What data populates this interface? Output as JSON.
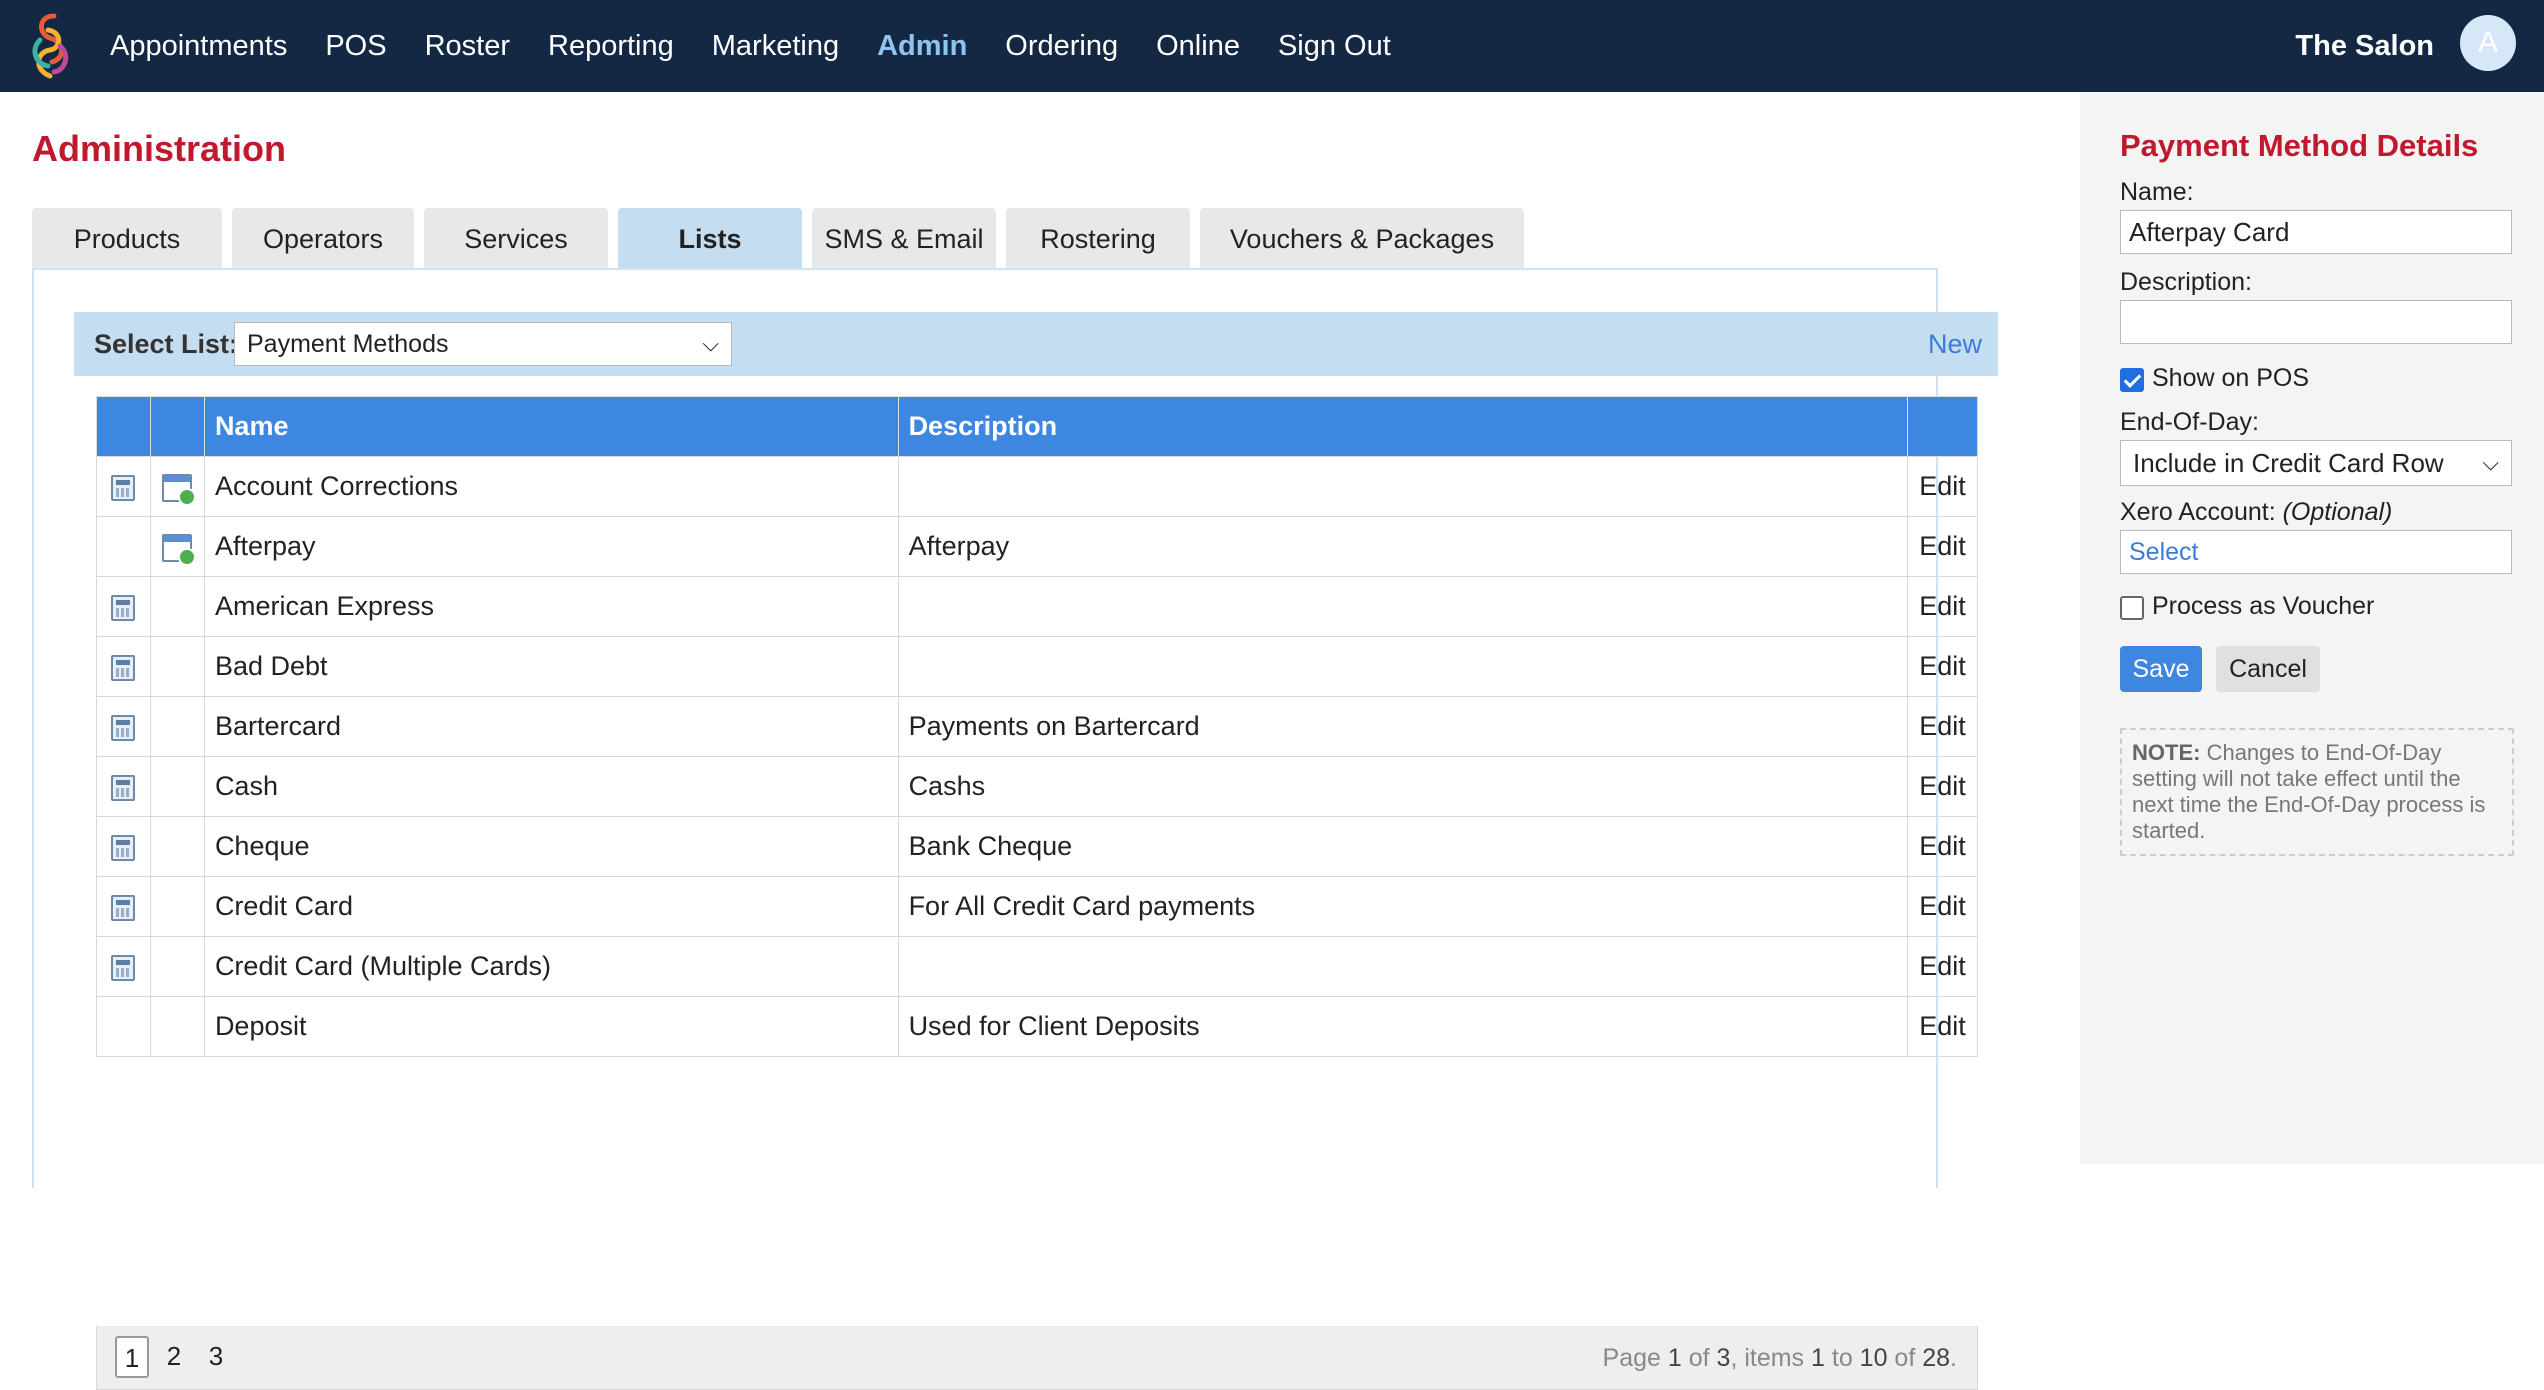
{
  "nav": {
    "items": [
      "Appointments",
      "POS",
      "Roster",
      "Reporting",
      "Marketing",
      "Admin",
      "Ordering",
      "Online",
      "Sign Out"
    ],
    "active": "Admin",
    "salon_name": "The Salon",
    "avatar_initial": "A"
  },
  "page": {
    "title": "Administration",
    "tabs": [
      "Products",
      "Operators",
      "Services",
      "Lists",
      "SMS & Email",
      "Rostering",
      "Vouchers & Packages"
    ],
    "active_tab": "Lists"
  },
  "list_selector": {
    "label": "Select List:",
    "selected": "Payment Methods",
    "new_label": "New"
  },
  "table": {
    "columns": [
      "",
      "",
      "Name",
      "Description",
      ""
    ],
    "edit_label": "Edit",
    "rows": [
      {
        "calc_icon": true,
        "cal_icon": true,
        "name": "Account Corrections",
        "description": ""
      },
      {
        "calc_icon": false,
        "cal_icon": true,
        "name": "Afterpay",
        "description": "Afterpay"
      },
      {
        "calc_icon": true,
        "cal_icon": false,
        "name": "American Express",
        "description": ""
      },
      {
        "calc_icon": true,
        "cal_icon": false,
        "name": "Bad Debt",
        "description": ""
      },
      {
        "calc_icon": true,
        "cal_icon": false,
        "name": "Bartercard",
        "description": "Payments on Bartercard"
      },
      {
        "calc_icon": true,
        "cal_icon": false,
        "name": "Cash",
        "description": "Cashs"
      },
      {
        "calc_icon": true,
        "cal_icon": false,
        "name": "Cheque",
        "description": "Bank Cheque"
      },
      {
        "calc_icon": true,
        "cal_icon": false,
        "name": "Credit Card",
        "description": "For All Credit Card payments"
      },
      {
        "calc_icon": true,
        "cal_icon": false,
        "name": "Credit Card (Multiple Cards)",
        "description": ""
      },
      {
        "calc_icon": false,
        "cal_icon": false,
        "name": "Deposit",
        "description": "Used for Client Deposits"
      }
    ]
  },
  "pager": {
    "pages": [
      "1",
      "2",
      "3"
    ],
    "current": "1",
    "info": {
      "page": "1",
      "of_pages": "3",
      "from": "1",
      "to": "10",
      "total": "28"
    },
    "words": {
      "page": "Page ",
      "of": " of ",
      "items": ", items ",
      "to": " to ",
      "of2": " of ",
      "end": "."
    }
  },
  "details": {
    "title": "Payment Method Details",
    "name_label": "Name:",
    "name_value": "Afterpay Card",
    "description_label": "Description:",
    "description_value": "",
    "show_on_pos_label": "Show on POS",
    "show_on_pos": true,
    "eod_label": "End-Of-Day:",
    "eod_value": "Include in Credit Card Row",
    "xero_label": "Xero Account:",
    "xero_optional": "(Optional)",
    "xero_value": "Select",
    "voucher_label": "Process as Voucher",
    "process_as_voucher": false,
    "save_label": "Save",
    "cancel_label": "Cancel",
    "note_bold": "NOTE:",
    "note_text": " Changes to End-Of-Day setting will not take effect until the next time the End-Of-Day process is started."
  }
}
